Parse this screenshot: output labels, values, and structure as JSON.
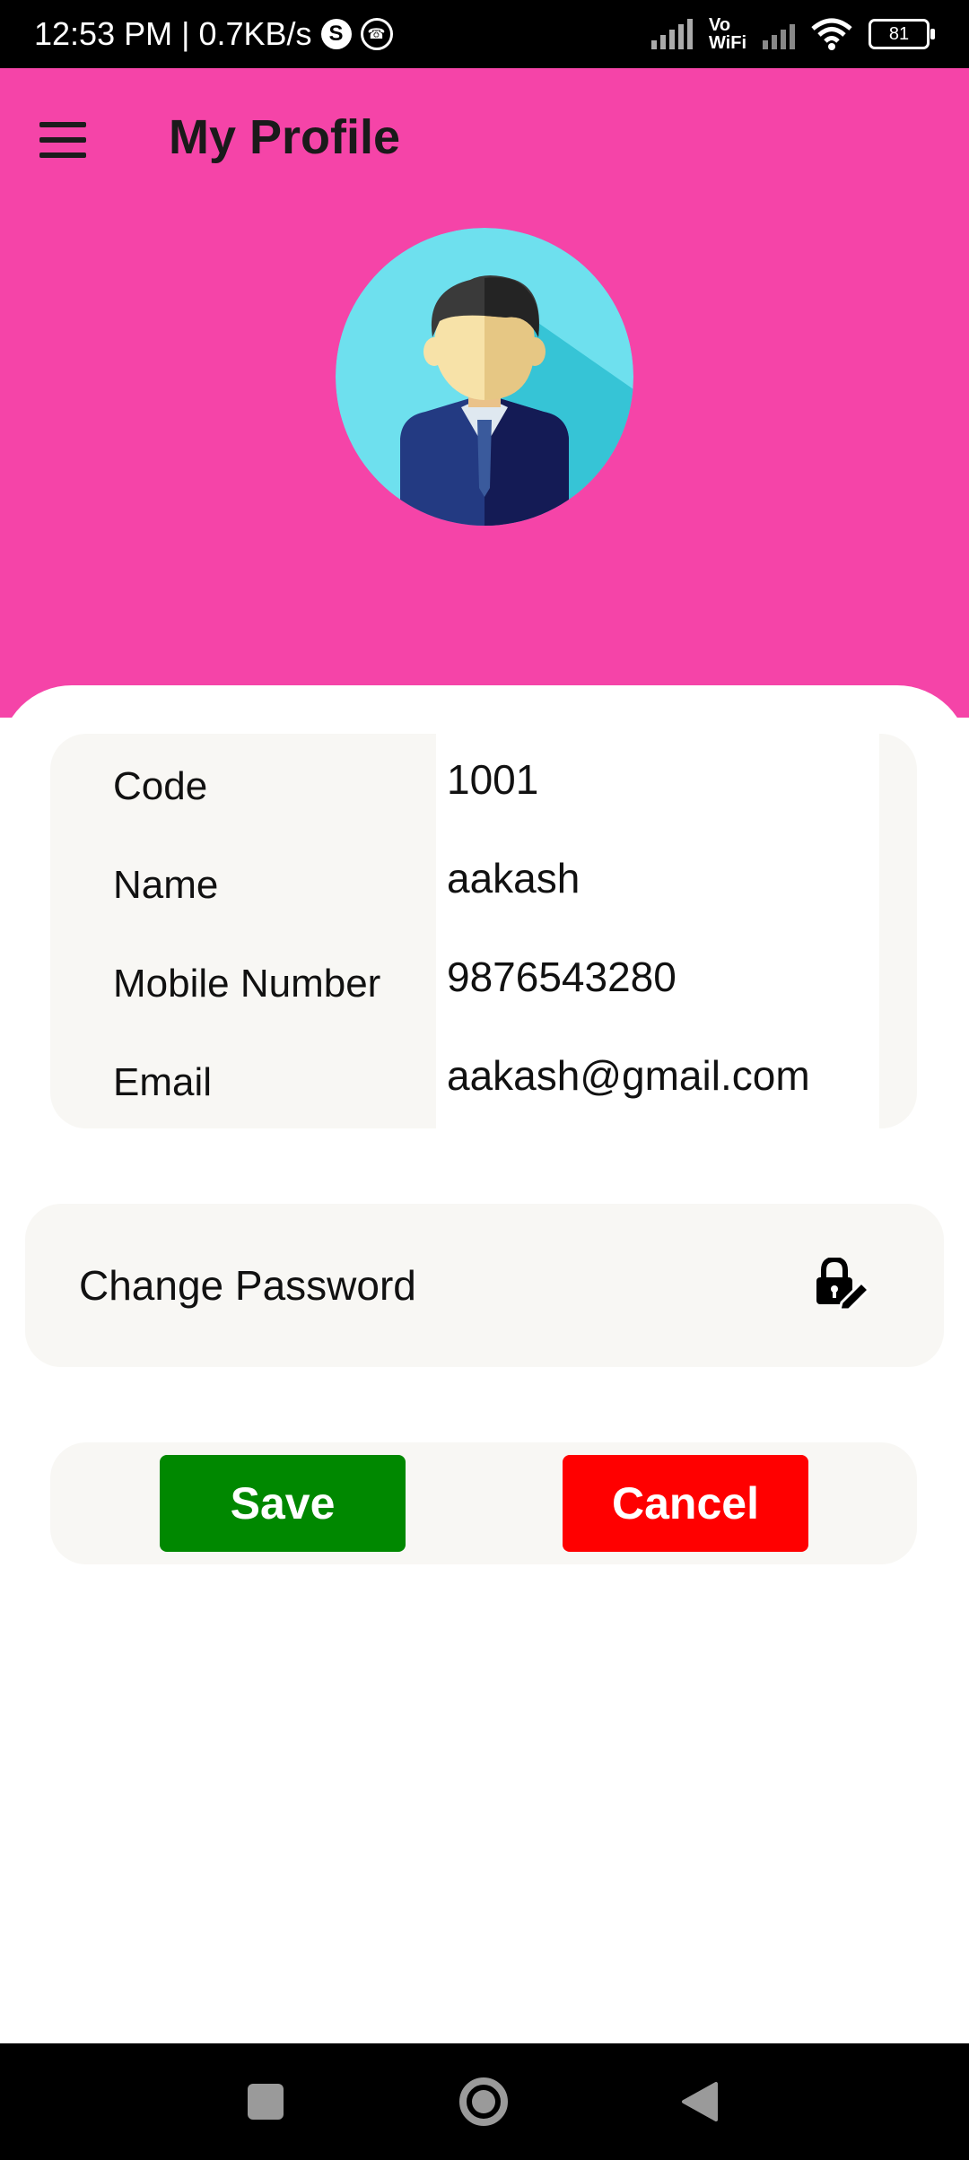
{
  "status_bar": {
    "time_speed": "12:53 PM | 0.7KB/s",
    "skype_badge": "S",
    "vowifi_top": "Vo",
    "vowifi_bottom": "WiFi",
    "battery": "81"
  },
  "header": {
    "title": "My Profile",
    "background_color": "#f544a8"
  },
  "profile": {
    "rows": [
      {
        "label": "Code",
        "value": "1001"
      },
      {
        "label": "Name",
        "value": "aakash"
      },
      {
        "label": "Mobile Number",
        "value": "9876543280"
      },
      {
        "label": "Email",
        "value": "aakash@gmail.com"
      }
    ]
  },
  "change_password": {
    "label": "Change Password",
    "icon": "lock-edit-icon"
  },
  "actions": {
    "save_label": "Save",
    "save_color": "#008800",
    "cancel_label": "Cancel",
    "cancel_color": "#ff0000"
  },
  "nav": {
    "icons": [
      "recents-square-icon",
      "home-circle-icon",
      "back-triangle-icon"
    ]
  }
}
